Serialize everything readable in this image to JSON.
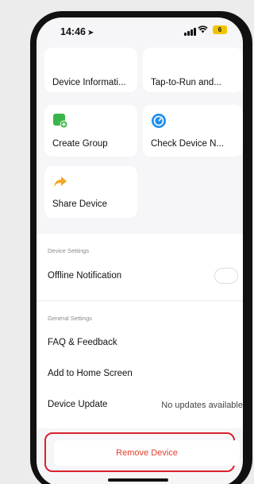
{
  "status_bar": {
    "time": "14:46",
    "battery": "6"
  },
  "nav": {
    "back_glyph": "‹"
  },
  "tiles": {
    "device_info": {
      "label": "Device Informati..."
    },
    "tap_to_run": {
      "label": "Tap-to-Run and..."
    },
    "create_group": {
      "label": "Create Group",
      "icon": "create-group-icon",
      "color": "#3bb54a"
    },
    "check_network": {
      "label": "Check Device N...",
      "icon": "network-check-icon",
      "color": "#1e8ff0"
    },
    "share_device": {
      "label": "Share Device",
      "icon": "share-icon",
      "color": "#f5a623"
    }
  },
  "device_settings": {
    "header": "Device Settings",
    "offline_notification": {
      "label": "Offline Notification",
      "enabled": false
    }
  },
  "general_settings": {
    "header": "General Settings",
    "faq": "FAQ & Feedback",
    "add_home": "Add to Home Screen",
    "device_update": {
      "label": "Device Update",
      "value": "No updates available"
    }
  },
  "remove": {
    "label": "Remove Device",
    "color": "#e0402f"
  }
}
